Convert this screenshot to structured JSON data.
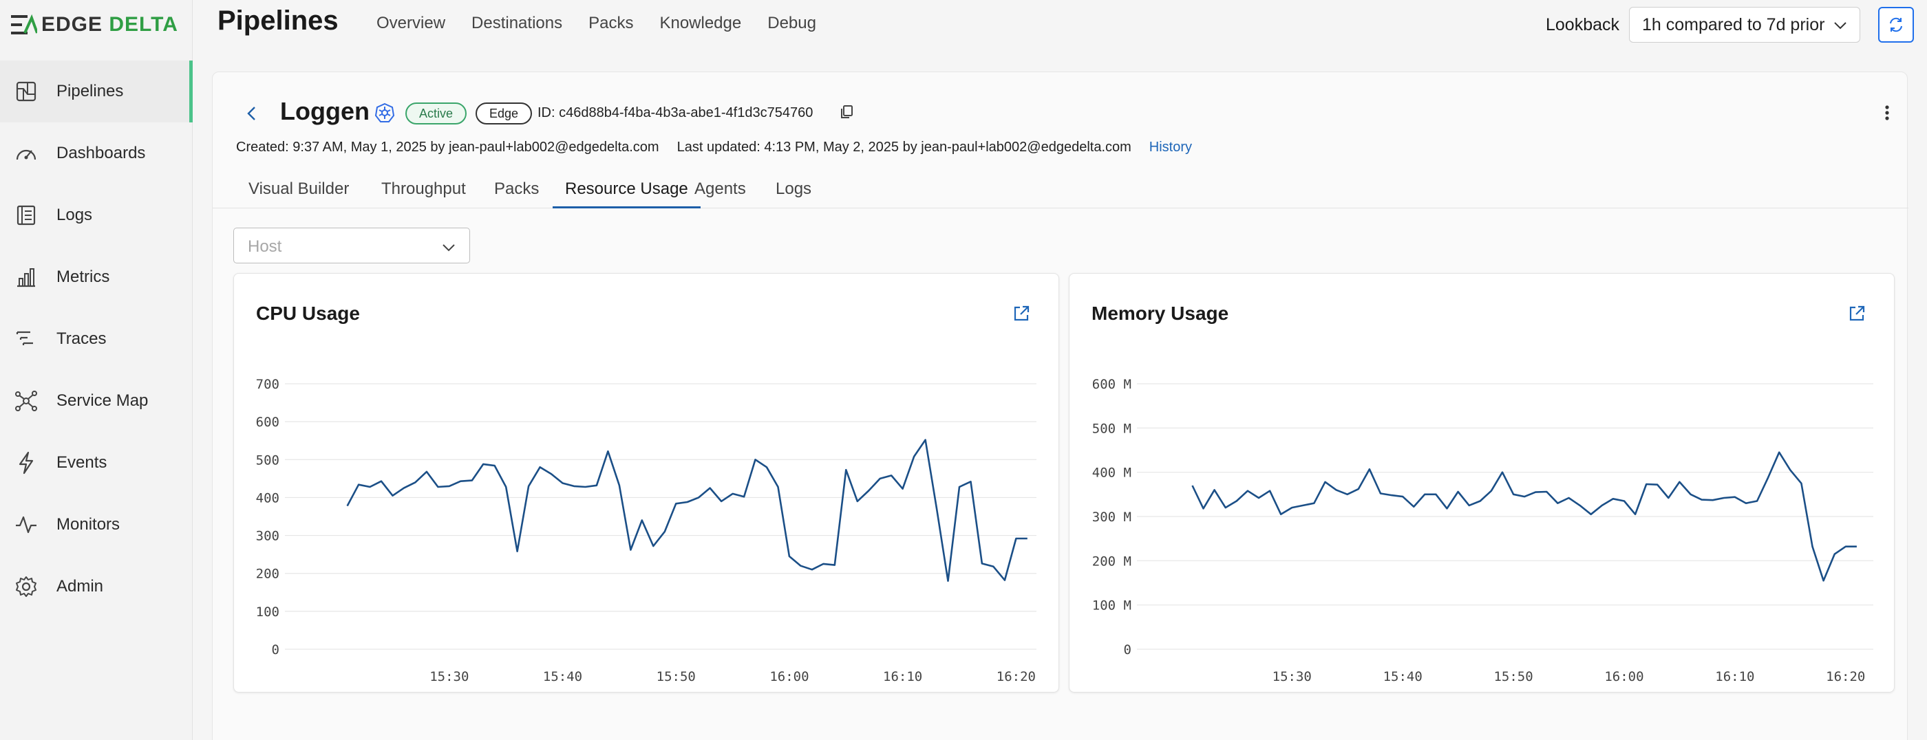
{
  "brand": {
    "name_part1": "EDGE",
    "name_part2": "DELTA",
    "accent_color": "#2f9e44"
  },
  "sidebar": {
    "items": [
      {
        "label": "Pipelines",
        "icon": "pipelines-icon",
        "active": true
      },
      {
        "label": "Dashboards",
        "icon": "gauge-icon"
      },
      {
        "label": "Logs",
        "icon": "logs-icon"
      },
      {
        "label": "Metrics",
        "icon": "bar-chart-icon"
      },
      {
        "label": "Traces",
        "icon": "traces-icon"
      },
      {
        "label": "Service Map",
        "icon": "network-icon"
      },
      {
        "label": "Events",
        "icon": "lightning-icon"
      },
      {
        "label": "Monitors",
        "icon": "pulse-icon"
      },
      {
        "label": "Admin",
        "icon": "gear-icon"
      }
    ]
  },
  "header": {
    "title": "Pipelines",
    "nav": [
      "Overview",
      "Destinations",
      "Packs",
      "Knowledge",
      "Debug"
    ],
    "lookback_label": "Lookback",
    "lookback_value": "1h compared to 7d prior"
  },
  "pipeline": {
    "name": "Loggen",
    "status": "Active",
    "type": "Edge",
    "id_text": "ID: c46d88b4-f4ba-4b3a-abe1-4f1d3c754760",
    "created": "Created: 9:37 AM, May 1, 2025 by jean-paul+lab002@edgedelta.com",
    "updated": "Last updated: 4:13 PM, May 2, 2025 by jean-paul+lab002@edgedelta.com",
    "history": "History"
  },
  "tabs": [
    "Visual Builder",
    "Throughput",
    "Packs",
    "Resource Usage",
    "Agents",
    "Logs"
  ],
  "active_tab": "Resource Usage",
  "host_select": {
    "placeholder": "Host"
  },
  "chart_data": [
    {
      "type": "line",
      "title": "CPU Usage",
      "ylim": [
        0,
        700
      ],
      "y_ticks": [
        0,
        100,
        200,
        300,
        400,
        500,
        600,
        700
      ],
      "y_tick_labels": [
        "0",
        "100",
        "200",
        "300",
        "400",
        "500",
        "600",
        "700"
      ],
      "x_ticks": [
        "15:30",
        "15:40",
        "15:50",
        "16:00",
        "16:10",
        "16:20"
      ],
      "x_range_minutes": [
        15.5,
        81.8
      ],
      "x_tick_minutes": [
        30,
        40,
        50,
        60,
        70,
        80
      ],
      "line_color": "#1b4f87",
      "series": [
        {
          "x": [
            21,
            22,
            23,
            24,
            25,
            26,
            27,
            28,
            29,
            30,
            31,
            32,
            33,
            34,
            35,
            36,
            37,
            38,
            39,
            40,
            41,
            42,
            43,
            44,
            45,
            46,
            47,
            48,
            49,
            50,
            51,
            52,
            53,
            54,
            55,
            56,
            57,
            58,
            59,
            60,
            61,
            62,
            63,
            64,
            65,
            66,
            67,
            68,
            69,
            70,
            71,
            72,
            73,
            74,
            75,
            76,
            77,
            78,
            79,
            80,
            81
          ],
          "y": [
            378,
            434,
            428,
            443,
            405,
            425,
            440,
            468,
            428,
            430,
            443,
            445,
            488,
            484,
            428,
            258,
            430,
            480,
            462,
            438,
            430,
            428,
            432,
            522,
            432,
            262,
            340,
            272,
            310,
            384,
            388,
            400,
            425,
            390,
            410,
            402,
            500,
            480,
            428,
            245,
            220,
            210,
            225,
            222,
            473,
            390,
            418,
            450,
            458,
            423,
            508,
            552,
            370,
            180,
            428,
            442,
            226,
            218,
            182,
            292,
            292
          ]
        }
      ]
    },
    {
      "type": "line",
      "title": "Memory Usage",
      "ylim": [
        0,
        600
      ],
      "y_ticks": [
        0,
        100,
        200,
        300,
        400,
        500,
        600
      ],
      "y_tick_labels": [
        "0",
        "100 M",
        "200 M",
        "300 M",
        "400 M",
        "500 M",
        "600 M"
      ],
      "x_ticks": [
        "15:30",
        "15:40",
        "15:50",
        "16:00",
        "16:10",
        "16:20"
      ],
      "x_range_minutes": [
        16,
        82.5
      ],
      "x_tick_minutes": [
        30,
        40,
        50,
        60,
        70,
        80
      ],
      "line_color": "#1b4f87",
      "series": [
        {
          "x": [
            21,
            22,
            23,
            24,
            25,
            26,
            27,
            28,
            29,
            30,
            31,
            32,
            33,
            34,
            35,
            36,
            37,
            38,
            39,
            40,
            41,
            42,
            43,
            44,
            45,
            46,
            47,
            48,
            49,
            50,
            51,
            52,
            53,
            54,
            55,
            56,
            57,
            58,
            59,
            60,
            61,
            62,
            63,
            64,
            65,
            66,
            67,
            68,
            69,
            70,
            71,
            72,
            73,
            74,
            75,
            76,
            77,
            78,
            79,
            80,
            81
          ],
          "y": [
            370,
            318,
            360,
            320,
            335,
            358,
            342,
            358,
            305,
            320,
            325,
            330,
            378,
            360,
            350,
            362,
            407,
            352,
            348,
            345,
            322,
            350,
            350,
            318,
            356,
            325,
            335,
            358,
            400,
            350,
            345,
            355,
            356,
            330,
            342,
            325,
            305,
            325,
            340,
            335,
            305,
            373,
            372,
            342,
            378,
            350,
            338,
            337,
            342,
            344,
            330,
            335,
            388,
            445,
            405,
            375,
            232,
            155,
            215,
            232,
            232
          ]
        }
      ]
    }
  ]
}
